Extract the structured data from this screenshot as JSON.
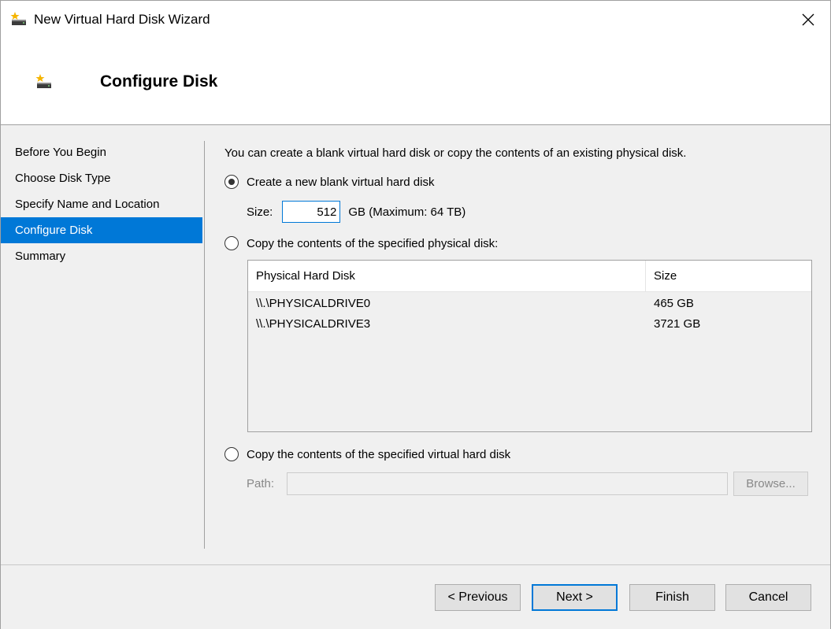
{
  "window": {
    "title": "New Virtual Hard Disk Wizard"
  },
  "header": {
    "title": "Configure Disk"
  },
  "nav": {
    "items": [
      {
        "label": "Before You Begin"
      },
      {
        "label": "Choose Disk Type"
      },
      {
        "label": "Specify Name and Location"
      },
      {
        "label": "Configure Disk",
        "selected": true
      },
      {
        "label": "Summary"
      }
    ]
  },
  "content": {
    "intro": "You can create a blank virtual hard disk or copy the contents of an existing physical disk.",
    "option_new": {
      "label": "Create a new blank virtual hard disk",
      "checked": true
    },
    "size": {
      "label": "Size:",
      "value": "512",
      "unit_text": "GB (Maximum: 64 TB)"
    },
    "option_physical": {
      "label": "Copy the contents of the specified physical disk:",
      "checked": false
    },
    "physical_list": {
      "columns": [
        "Physical Hard Disk",
        "Size"
      ],
      "rows": [
        {
          "disk": "\\\\.\\PHYSICALDRIVE0",
          "size": "465 GB"
        },
        {
          "disk": "\\\\.\\PHYSICALDRIVE3",
          "size": "3721 GB"
        }
      ]
    },
    "option_virtual": {
      "label": "Copy the contents of the specified virtual hard disk",
      "checked": false
    },
    "path": {
      "label": "Path:",
      "value": "",
      "browse_label": "Browse..."
    }
  },
  "footer": {
    "previous_label": "< Previous",
    "next_label": "Next >",
    "finish_label": "Finish",
    "cancel_label": "Cancel"
  },
  "icons": {
    "app": "disk-wizard-icon",
    "close": "close-icon"
  },
  "colors": {
    "accent": "#0078d7",
    "panel_bg": "#f0f0f0"
  }
}
